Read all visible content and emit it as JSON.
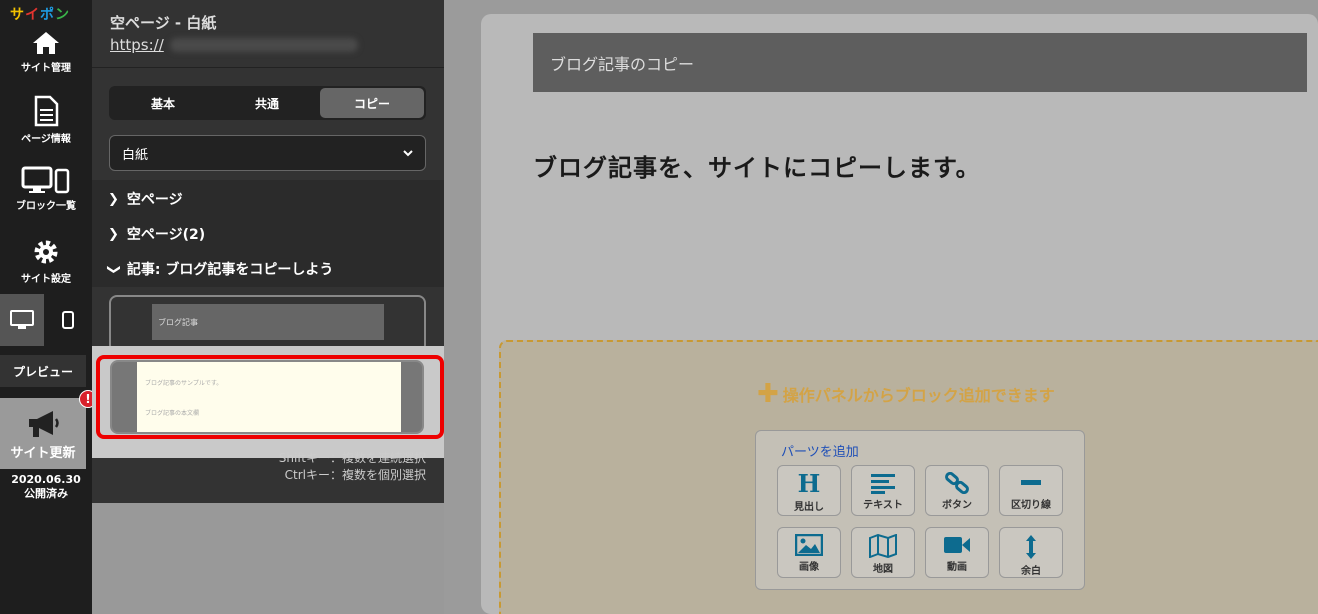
{
  "rail": {
    "logo": "サイポン",
    "logo_colors": [
      "#f2c200",
      "#e3342f",
      "#1e9ae0",
      "#39b54a"
    ],
    "items": [
      {
        "label": "サイト管理",
        "icon": "home-icon"
      },
      {
        "label": "ページ情報",
        "icon": "document-icon"
      },
      {
        "label": "ブロック一覧",
        "icon": "monitor-mobile-icon"
      },
      {
        "label": "サイト設定",
        "icon": "gear-icon"
      }
    ],
    "preview_label": "プレビュー",
    "update_label": "サイト更新",
    "update_badge": "!",
    "publish_date": "2020.06.30",
    "publish_status": "公開済み"
  },
  "panel": {
    "title": "空ページ - 白紙",
    "url": "https://",
    "tabs": [
      {
        "label": "基本",
        "active": false
      },
      {
        "label": "共通",
        "active": false
      },
      {
        "label": "コピー",
        "active": true
      }
    ],
    "select_value": "白紙",
    "tree": [
      {
        "label": "空ページ",
        "expanded": false
      },
      {
        "label": "空ページ(2)",
        "expanded": false
      },
      {
        "label": "記事: ブログ記事をコピーしよう",
        "expanded": true
      }
    ],
    "thumb1_text": "ブログ記事",
    "thumb2_line1": "ブログ記事のサンプルです。",
    "thumb2_line2": "ブログ記事の本文欄",
    "hint_shift": "Shiftキー：複数を連続選択",
    "hint_ctrl": "Ctrlキー：複数を個別選択"
  },
  "preview": {
    "copy_bar": "ブログ記事のコピー",
    "heading": "ブログ記事を、サイトにコピーします。",
    "add_block_msg": "操作パネルからブロック追加できます",
    "parts_title": "パーツを追加",
    "parts": [
      {
        "label": "見出し",
        "icon": "heading-icon"
      },
      {
        "label": "テキスト",
        "icon": "text-icon"
      },
      {
        "label": "ボタン",
        "icon": "link-icon"
      },
      {
        "label": "区切り線",
        "icon": "divider-icon"
      },
      {
        "label": "画像",
        "icon": "image-icon"
      },
      {
        "label": "地図",
        "icon": "map-icon"
      },
      {
        "label": "動画",
        "icon": "video-icon"
      },
      {
        "label": "余白",
        "icon": "spacing-icon"
      }
    ]
  }
}
